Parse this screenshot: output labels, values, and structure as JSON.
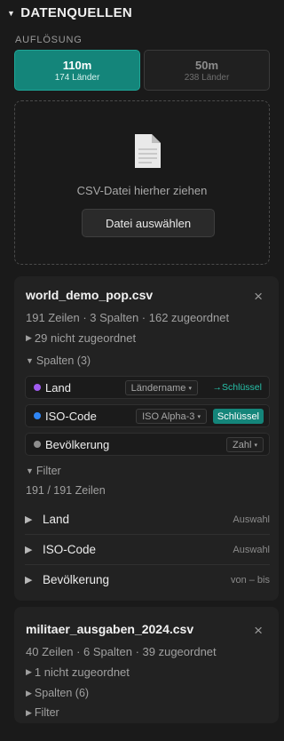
{
  "section": {
    "title": "DATENQUELLEN",
    "resolution_label": "AUFLÖSUNG"
  },
  "resolution_options": [
    {
      "label": "110m",
      "sub": "174 Länder",
      "active": true
    },
    {
      "label": "50m",
      "sub": "238 Länder",
      "active": false
    }
  ],
  "dropzone": {
    "text": "CSV-Datei hierher ziehen",
    "button": "Datei auswählen"
  },
  "files": [
    {
      "name": "world_demo_pop.csv",
      "close": "×",
      "meta": "191 Zeilen · 3 Spalten · 162 zugeordnet",
      "unmatched": "29 nicht zugeordnet",
      "columns_toggle": "Spalten (3)",
      "columns": [
        {
          "name": "Land",
          "color": "#a15cf0",
          "type": "Ländername",
          "key_text": "→Schlüssel",
          "key_active": false
        },
        {
          "name": "ISO-Code",
          "color": "#2f86f6",
          "type": "ISO Alpha-3",
          "key_text": "Schlüssel",
          "key_active": true
        },
        {
          "name": "Bevölkerung",
          "color": "#8e8e8e",
          "type": "Zahl"
        }
      ],
      "filter_toggle": "Filter",
      "filter_count": "191 / 191 Zeilen",
      "filters": [
        {
          "name": "Land",
          "hint": "Auswahl"
        },
        {
          "name": "ISO-Code",
          "hint": "Auswahl"
        },
        {
          "name": "Bevölkerung",
          "hint": "von – bis"
        }
      ]
    },
    {
      "name": "militaer_ausgaben_2024.csv",
      "close": "×",
      "meta": "40 Zeilen · 6 Spalten · 39 zugeordnet",
      "unmatched": "1 nicht zugeordnet",
      "columns_toggle": "Spalten (6)",
      "filter_toggle": "Filter"
    }
  ],
  "icons": {
    "section_toggle": "triangle-down-icon",
    "file": "document-icon",
    "close": "close-icon",
    "collapsed": "triangle-right-icon",
    "expanded": "triangle-down-icon",
    "dropdown": "chevron-down-icon"
  },
  "colors": {
    "accent": "#14857a",
    "accent_text": "#27c0a9",
    "background": "#1a1a1a",
    "card": "#222222"
  }
}
